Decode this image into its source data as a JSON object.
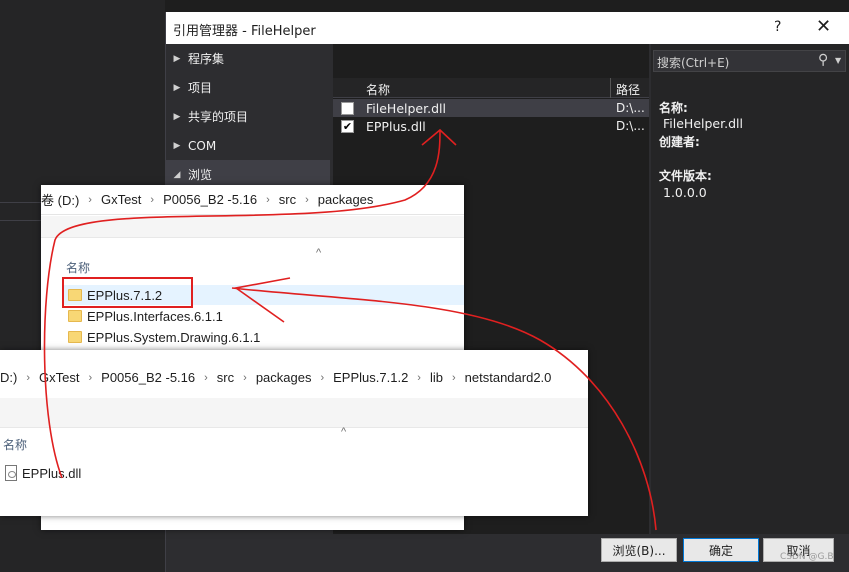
{
  "dialog": {
    "title": "引用管理器 - FileHelper",
    "help_label": "?",
    "close_label": "✕"
  },
  "nav": {
    "items": [
      {
        "label": "程序集",
        "arrow": "▶"
      },
      {
        "label": "项目",
        "arrow": "▶"
      },
      {
        "label": "共享的项目",
        "arrow": "▶"
      },
      {
        "label": "COM",
        "arrow": "▶"
      },
      {
        "label": "浏览",
        "arrow": "◢"
      }
    ]
  },
  "list": {
    "col_name": "名称",
    "col_path": "路径",
    "rows": [
      {
        "checked": false,
        "name": "FileHelper.dll",
        "path": "D:\\..."
      },
      {
        "checked": true,
        "name": "EPPlus.dll",
        "path": "D:\\..."
      }
    ]
  },
  "search": {
    "placeholder": "搜索(Ctrl+E)",
    "icon": "search-icon"
  },
  "details": {
    "name_label": "名称:",
    "name_value": "FileHelper.dll",
    "creator_label": "创建者:",
    "version_label": "文件版本:",
    "version_value": "1.0.0.0"
  },
  "buttons": {
    "browse": "浏览(B)...",
    "ok": "确定",
    "cancel": "取消"
  },
  "explorer1": {
    "crumbs": [
      "卷 (D:)",
      "GxTest",
      "P0056_B2 -5.16",
      "src",
      "packages"
    ],
    "col_name": "名称",
    "items": [
      "EPPlus.7.1.2",
      "EPPlus.Interfaces.6.1.1",
      "EPPlus.System.Drawing.6.1.1"
    ]
  },
  "explorer2": {
    "crumbs": [
      "D:)",
      "GxTest",
      "P0056_B2 -5.16",
      "src",
      "packages",
      "EPPlus.7.1.2",
      "lib",
      "netstandard2.0"
    ],
    "col_name": "名称",
    "items": [
      "EPPlus.dll"
    ]
  },
  "watermark": "CSDN @G.B",
  "colors": {
    "annotation": "#e02020",
    "dialog_bg": "#2d2d30",
    "selection": "#3f3f46"
  }
}
